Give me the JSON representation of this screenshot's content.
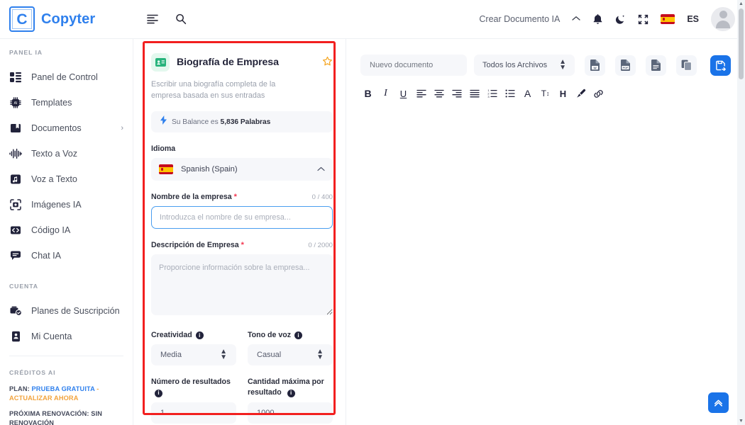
{
  "brand": {
    "mark": "C",
    "name": "Copyter"
  },
  "navbar": {
    "menu_icon": "menu-icon",
    "search_icon": "search-icon",
    "create_doc_label": "Crear Documento IA",
    "chevron_icon": "chevron-up-icon",
    "bell_icon": "bell-icon",
    "dark_mode_icon": "moon-icon",
    "fullscreen_icon": "fullscreen-icon",
    "language_code": "ES",
    "language_flag": "spain-flag-icon",
    "avatar": "user-avatar"
  },
  "sidebar": {
    "section_panel": "PANEL IA",
    "items": [
      {
        "label": "Panel de Control",
        "icon": "dashboard-icon"
      },
      {
        "label": "Templates",
        "icon": "ai-chip-icon"
      },
      {
        "label": "Documentos",
        "icon": "bookmark-folder-icon",
        "caret": "›"
      },
      {
        "label": "Texto a Voz",
        "icon": "waveform-icon"
      },
      {
        "label": "Voz a Texto",
        "icon": "music-note-icon"
      },
      {
        "label": "Imágenes IA",
        "icon": "camera-frame-icon"
      },
      {
        "label": "Código IA",
        "icon": "code-icon"
      },
      {
        "label": "Chat IA",
        "icon": "chat-icon"
      }
    ],
    "section_account": "CUENTA",
    "account_items": [
      {
        "label": "Planes de Suscripción",
        "icon": "subscription-icon"
      },
      {
        "label": "Mi Cuenta",
        "icon": "account-card-icon"
      }
    ],
    "section_credits": "CRÉDITOS AI",
    "plan_prefix": "PLAN:",
    "plan_value": "PRUEBA GRATUITA",
    "plan_sep": "-",
    "plan_upgrade": "ACTUALIZAR AHORA",
    "renewal": "PRÓXIMA RENOVACIÓN: SIN RENOVACIÓN"
  },
  "form": {
    "badge_icon": "id-card-icon",
    "title": "Biografía de Empresa",
    "star_icon": "star-icon",
    "description": "Escribir una biografía completa de la empresa basada en sus entradas",
    "balance_icon": "lightning-icon",
    "balance_prefix": "Su Balance es",
    "balance_value": "5,836 Palabras",
    "language_label": "Idioma",
    "language_value": "Spanish (Spain)",
    "language_flag": "spain-flag-icon",
    "language_caret": "chevron-up-icon",
    "company_label": "Nombre de la empresa",
    "company_required": "*",
    "company_count": "0 / 400",
    "company_placeholder": "Introduzca el nombre de su empresa...",
    "company_value": "",
    "desc_label": "Descripción de Empresa",
    "desc_required": "*",
    "desc_count": "0 / 2000",
    "desc_placeholder": "Proporcione información sobre la empresa...",
    "desc_value": "",
    "creativity_label": "Creatividad",
    "creativity_value": "Media",
    "tone_label": "Tono de voz",
    "tone_value": "Casual",
    "results_label": "Número de resultados",
    "results_value": "1",
    "max_label": "Cantidad máxima por resultado",
    "max_value": "1000",
    "info_icon": "info-icon",
    "highlight_color": "#f21f1f"
  },
  "editor": {
    "doc_name_placeholder": "Nuevo documento",
    "doc_name_value": "",
    "filter_value": "Todos los Archivos",
    "filter_caret": "chevron-updown-icon",
    "export_buttons": [
      {
        "name": "export-word-button",
        "label": "W"
      },
      {
        "name": "export-pdf-button",
        "label": "PDF"
      },
      {
        "name": "export-text-button",
        "label": "TXT"
      },
      {
        "name": "copy-button",
        "label": "COPY"
      },
      {
        "name": "save-button",
        "label": "SAVE"
      }
    ],
    "format_tools": [
      {
        "name": "bold-icon",
        "glyph": "B"
      },
      {
        "name": "italic-icon",
        "glyph": "I"
      },
      {
        "name": "underline-icon",
        "glyph": "U"
      },
      {
        "name": "align-left-icon",
        "glyph": "≡"
      },
      {
        "name": "align-center-icon",
        "glyph": "≡"
      },
      {
        "name": "align-right-icon",
        "glyph": "≡"
      },
      {
        "name": "align-justify-icon",
        "glyph": "≡"
      },
      {
        "name": "ordered-list-icon",
        "glyph": "≔"
      },
      {
        "name": "bullet-list-icon",
        "glyph": "☰"
      },
      {
        "name": "font-color-icon",
        "glyph": "A"
      },
      {
        "name": "font-size-icon",
        "glyph": "T↕"
      },
      {
        "name": "heading-icon",
        "glyph": "H"
      },
      {
        "name": "highlight-brush-icon",
        "glyph": "✎"
      },
      {
        "name": "link-icon",
        "glyph": "🔗"
      }
    ],
    "content": "",
    "accent_color": "#1a73e8"
  },
  "fab": {
    "icon": "double-chevron-up-icon"
  }
}
